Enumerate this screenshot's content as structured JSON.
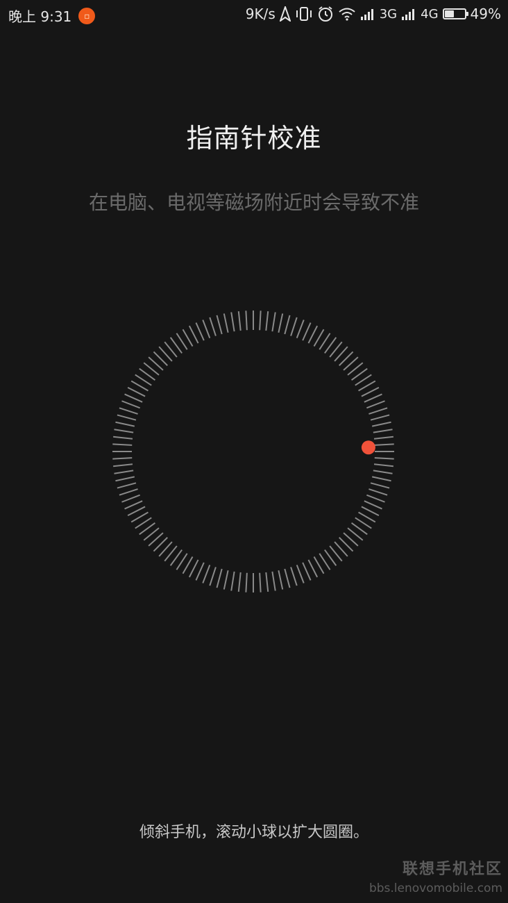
{
  "status_bar": {
    "time": "晚上 9:31",
    "speed": "9K/s",
    "network_1": "3G",
    "network_2": "4G",
    "battery_text": "49%",
    "battery_level": 49,
    "icons": [
      "notification-app-icon",
      "location-icon",
      "vibrate-icon",
      "alarm-icon",
      "wifi-icon",
      "signal-icon",
      "signal-icon",
      "battery-icon"
    ]
  },
  "title": "指南针校准",
  "subtitle": "在电脑、电视等磁场附近时会导致不准",
  "dial": {
    "tick_count": 120,
    "ball_angle_deg": 88,
    "ball_color": "#f0523a",
    "tick_color": "#8a8a8a"
  },
  "hint": "倾斜手机，滚动小球以扩大圆圈。",
  "watermark": {
    "title": "联想手机社区",
    "url": "bbs.lenovomobile.com"
  }
}
